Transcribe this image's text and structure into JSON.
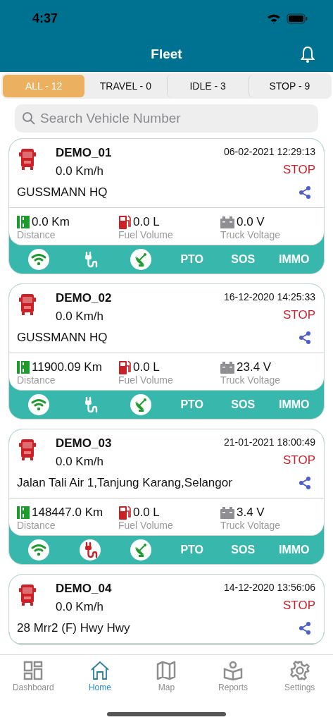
{
  "status_bar": {
    "time": "4:37"
  },
  "header": {
    "title": "Fleet"
  },
  "filters": [
    {
      "label": "ALL - 12",
      "selected": true
    },
    {
      "label": "TRAVEL - 0",
      "selected": false
    },
    {
      "label": "IDLE - 3",
      "selected": false
    },
    {
      "label": "STOP - 9",
      "selected": false
    }
  ],
  "search": {
    "placeholder": "Search Vehicle Number"
  },
  "vehicles": [
    {
      "name": "DEMO_01",
      "speed": "0.0 Km/h",
      "timestamp": "06-02-2021 12:29:13",
      "status": "STOP",
      "location": "GUSSMANN HQ",
      "distance": "0.0 Km",
      "distance_label": "Distance",
      "fuel": "0.0 L",
      "fuel_label": "Fuel Volume",
      "voltage": "0.0 V",
      "voltage_label": "Truck Voltage",
      "indicators": [
        {
          "kind": "wifi",
          "on": true
        },
        {
          "kind": "power",
          "on": false
        },
        {
          "kind": "gps",
          "on": true
        },
        {
          "kind": "text",
          "label": "PTO",
          "on": false
        },
        {
          "kind": "text",
          "label": "SOS",
          "on": false
        },
        {
          "kind": "text",
          "label": "IMMO",
          "on": false
        }
      ]
    },
    {
      "name": "DEMO_02",
      "speed": "0.0 Km/h",
      "timestamp": "16-12-2020 14:25:33",
      "status": "STOP",
      "location": "GUSSMANN HQ",
      "distance": "11900.09 Km",
      "distance_label": "Distance",
      "fuel": "0.0 L",
      "fuel_label": "Fuel Volume",
      "voltage": "23.4 V",
      "voltage_label": "Truck Voltage",
      "indicators": [
        {
          "kind": "wifi",
          "on": true
        },
        {
          "kind": "power",
          "on": false
        },
        {
          "kind": "gps",
          "on": true
        },
        {
          "kind": "text",
          "label": "PTO",
          "on": false
        },
        {
          "kind": "text",
          "label": "SOS",
          "on": false
        },
        {
          "kind": "text",
          "label": "IMMO",
          "on": false
        }
      ]
    },
    {
      "name": "DEMO_03",
      "speed": "0.0 Km/h",
      "timestamp": "21-01-2021 18:00:49",
      "status": "STOP",
      "location": "Jalan Tali Air 1,Tanjung Karang,Selangor",
      "distance": "148447.0 Km",
      "distance_label": "Distance",
      "fuel": "0.0 L",
      "fuel_label": "Fuel Volume",
      "voltage": "3.4 V",
      "voltage_label": "Truck Voltage",
      "indicators": [
        {
          "kind": "wifi",
          "on": true
        },
        {
          "kind": "power",
          "on": true
        },
        {
          "kind": "gps",
          "on": true
        },
        {
          "kind": "text",
          "label": "PTO",
          "on": false
        },
        {
          "kind": "text",
          "label": "SOS",
          "on": false
        },
        {
          "kind": "text",
          "label": "IMMO",
          "on": false
        }
      ]
    },
    {
      "name": "DEMO_04",
      "speed": "0.0 Km/h",
      "timestamp": "14-12-2020 13:56:06",
      "status": "STOP",
      "location": "28 Mrr2 (F) Hwy Hwy"
    }
  ],
  "tab_bar": [
    {
      "label": "Dashboard",
      "kind": "dashboard",
      "selected": false
    },
    {
      "label": "Home",
      "kind": "home",
      "selected": true
    },
    {
      "label": "Map",
      "kind": "map",
      "selected": false
    },
    {
      "label": "Reports",
      "kind": "reports",
      "selected": false
    },
    {
      "label": "Settings",
      "kind": "settings",
      "selected": false
    }
  ]
}
